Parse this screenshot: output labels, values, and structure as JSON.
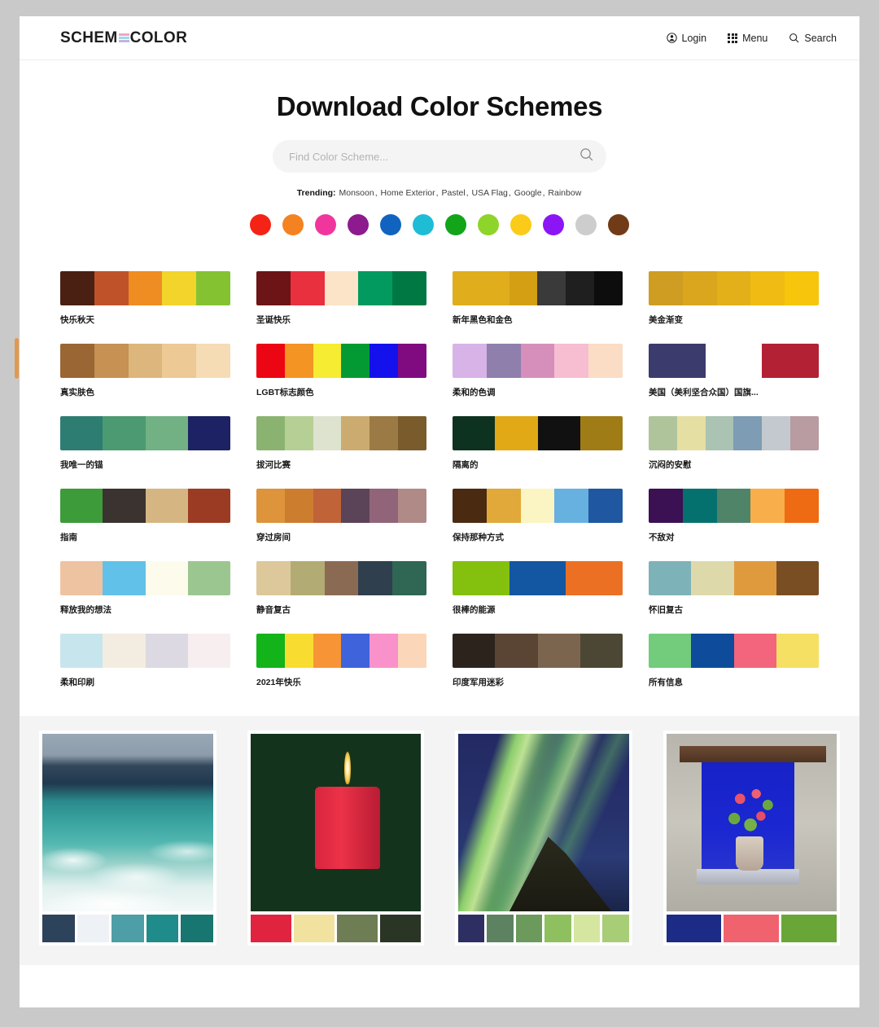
{
  "header": {
    "logo_text_a": "SCHEM",
    "logo_text_b": "COLOR",
    "logo_stripe_colors": [
      "#f2a7c3",
      "#9fd8e8",
      "#c2b3e0",
      "#f5b8d0"
    ],
    "nav": [
      {
        "label": "Login",
        "icon": "user-icon"
      },
      {
        "label": "Menu",
        "icon": "grid-menu-icon"
      },
      {
        "label": "Search",
        "icon": "search-icon"
      }
    ]
  },
  "hero": {
    "title": "Download Color Schemes",
    "search_placeholder": "Find Color Scheme...",
    "search_value": "",
    "search_icon": "search-icon",
    "trending_label": "Trending:",
    "trending_links": [
      "Monsoon",
      "Home Exterior",
      "Pastel",
      "USA Flag",
      "Google",
      "Rainbow"
    ],
    "color_dots": [
      {
        "name": "red",
        "hex": "#f42315"
      },
      {
        "name": "orange",
        "hex": "#f58220"
      },
      {
        "name": "pink",
        "hex": "#f0369c"
      },
      {
        "name": "purple",
        "hex": "#8d1b8d"
      },
      {
        "name": "blue",
        "hex": "#1064c0"
      },
      {
        "name": "cyan",
        "hex": "#1fbcd6"
      },
      {
        "name": "green",
        "hex": "#12a51a"
      },
      {
        "name": "lime",
        "hex": "#8ed42a"
      },
      {
        "name": "yellow",
        "hex": "#fbcb19"
      },
      {
        "name": "violet",
        "hex": "#8c15f5"
      },
      {
        "name": "gray",
        "hex": "#cdcdcd"
      },
      {
        "name": "brown",
        "hex": "#713b17"
      }
    ]
  },
  "schemes": [
    {
      "name": "快乐秋天",
      "colors": [
        "#4a2012",
        "#c0522a",
        "#ef8c22",
        "#f2d42a",
        "#85c232"
      ]
    },
    {
      "name": "圣诞快乐",
      "colors": [
        "#6d1416",
        "#e8303f",
        "#fbe4c8",
        "#029a5e",
        "#007844"
      ]
    },
    {
      "name": "新年黑色和金色",
      "colors": [
        "#e0ae1c",
        "#e0ae1c",
        "#d59f14",
        "#3a3a3a",
        "#1f1f1f",
        "#0d0d0d"
      ]
    },
    {
      "name": "美金渐变",
      "colors": [
        "#cf9d21",
        "#d9a61d",
        "#e4b019",
        "#f0bc13",
        "#f6c50c"
      ]
    },
    {
      "name": "真实肤色",
      "colors": [
        "#9a6633",
        "#c69152",
        "#ddb67d",
        "#ecc995",
        "#f5dcb4"
      ]
    },
    {
      "name": "LGBT标志颜色",
      "colors": [
        "#ec0512",
        "#f39423",
        "#f6ec31",
        "#049a33",
        "#1511ec",
        "#800a80"
      ]
    },
    {
      "name": "柔和的色调",
      "colors": [
        "#d7b3e8",
        "#8f7fad",
        "#d68fba",
        "#f7bdd1",
        "#fbdcc5"
      ]
    },
    {
      "name": "美国（美利坚合众国）国旗...",
      "colors": [
        "#3c3b6e",
        "#ffffff",
        "#b22234"
      ]
    },
    {
      "name": "我唯一的锚",
      "colors": [
        "#2e7d72",
        "#4c9a72",
        "#71b183",
        "#1c2263"
      ]
    },
    {
      "name": "拔河比赛",
      "colors": [
        "#8ab372",
        "#b6cf95",
        "#dde3cf",
        "#cbab70",
        "#9b7a45",
        "#7a5c2c"
      ]
    },
    {
      "name": "隔离的",
      "colors": [
        "#0d3320",
        "#e1a915",
        "#111111",
        "#a07c17"
      ]
    },
    {
      "name": "沉闷的安慰",
      "colors": [
        "#b0c49c",
        "#e6dfa3",
        "#aac3b2",
        "#7e9cb4",
        "#c3c9cf",
        "#b99ba2"
      ]
    },
    {
      "name": "指南",
      "colors": [
        "#3d9b3a",
        "#3a332f",
        "#d5b683",
        "#9c3b23"
      ]
    },
    {
      "name": "穿过房间",
      "colors": [
        "#dd943a",
        "#cd7d2e",
        "#c06338",
        "#5c4458",
        "#92647a",
        "#b08a87"
      ]
    },
    {
      "name": "保持那种方式",
      "colors": [
        "#4b2a12",
        "#e1a93a",
        "#faf5c2",
        "#66b1e0",
        "#1f58a0"
      ]
    },
    {
      "name": "不敌对",
      "colors": [
        "#3b1153",
        "#05716e",
        "#4f8469",
        "#f8ae4a",
        "#ee6a13"
      ]
    },
    {
      "name": "释放我的想法",
      "colors": [
        "#eec3a2",
        "#62c1e8",
        "#fdfbec",
        "#9cc68f"
      ]
    },
    {
      "name": "静音复古",
      "colors": [
        "#ddc89c",
        "#b3ab74",
        "#8b6a54",
        "#2f3f4e",
        "#2f6654"
      ]
    },
    {
      "name": "很棒的能源",
      "colors": [
        "#84c10f",
        "#1356a2",
        "#ec7024"
      ]
    },
    {
      "name": "怀旧复古",
      "colors": [
        "#7eb2b9",
        "#ded9aa",
        "#e09a3e",
        "#7a4e23"
      ]
    },
    {
      "name": "柔和印刷",
      "colors": [
        "#c7e5ec",
        "#f3ece0",
        "#dcd9e2",
        "#f7eef0"
      ]
    },
    {
      "name": "2021年快乐",
      "colors": [
        "#13b31a",
        "#f8dd30",
        "#f79536",
        "#3f63da",
        "#f992cb",
        "#fbd6b8"
      ]
    },
    {
      "name": "印度军用迷彩",
      "colors": [
        "#2c231d",
        "#5a4434",
        "#7c654f",
        "#4c4734"
      ]
    },
    {
      "name": "所有信息",
      "colors": [
        "#73cb7c",
        "#0e4b9a",
        "#f2657c",
        "#f5e063"
      ]
    }
  ],
  "photo_cards": [
    {
      "name": "ocean-waves",
      "palette": [
        "#2d435c",
        "#eef1f5",
        "#4d9ea6",
        "#1f8b8a",
        "#17766f"
      ]
    },
    {
      "name": "red-candle",
      "palette": [
        "#e0243f",
        "#f2e2a0",
        "#6e7d53",
        "#2a3526"
      ]
    },
    {
      "name": "aurora-borealis",
      "palette": [
        "#2d2f63",
        "#5d8262",
        "#6b9a5c",
        "#8fc060",
        "#d4e6a0",
        "#a8cd77"
      ]
    },
    {
      "name": "blue-window-flowers",
      "palette": [
        "#1b2b86",
        "#f0626e",
        "#6aa637"
      ]
    }
  ]
}
